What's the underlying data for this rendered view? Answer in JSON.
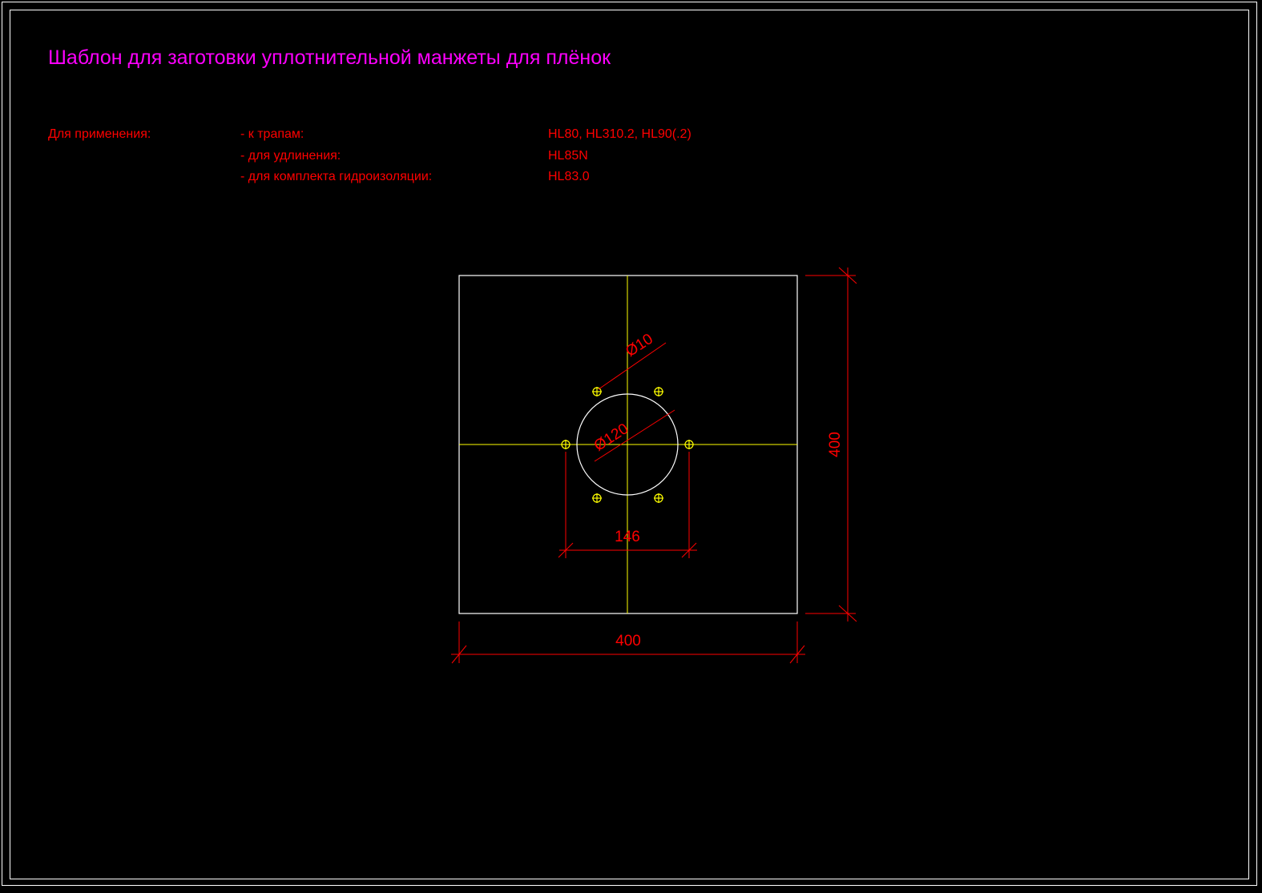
{
  "title": "Шаблон для заготовки уплотнительной манжеты для плёнок",
  "application": {
    "label": "Для применения:",
    "rows": [
      {
        "item": "- к трапам:",
        "value": "HL80, HL310.2, HL90(.2)"
      },
      {
        "item": "- для удлинения:",
        "value": "HL85N"
      },
      {
        "item": "- для комплекта гидроизоляции:",
        "value": "HL83.0"
      }
    ]
  },
  "dimensions": {
    "width": "400",
    "height": "400",
    "hole_diameter": "Ø10",
    "center_diameter": "Ø120",
    "hole_spacing": "146"
  },
  "colors": {
    "title": "#ff00ff",
    "dimension": "#ff0000",
    "outline": "#ffffff",
    "centerline": "#ffff00"
  }
}
